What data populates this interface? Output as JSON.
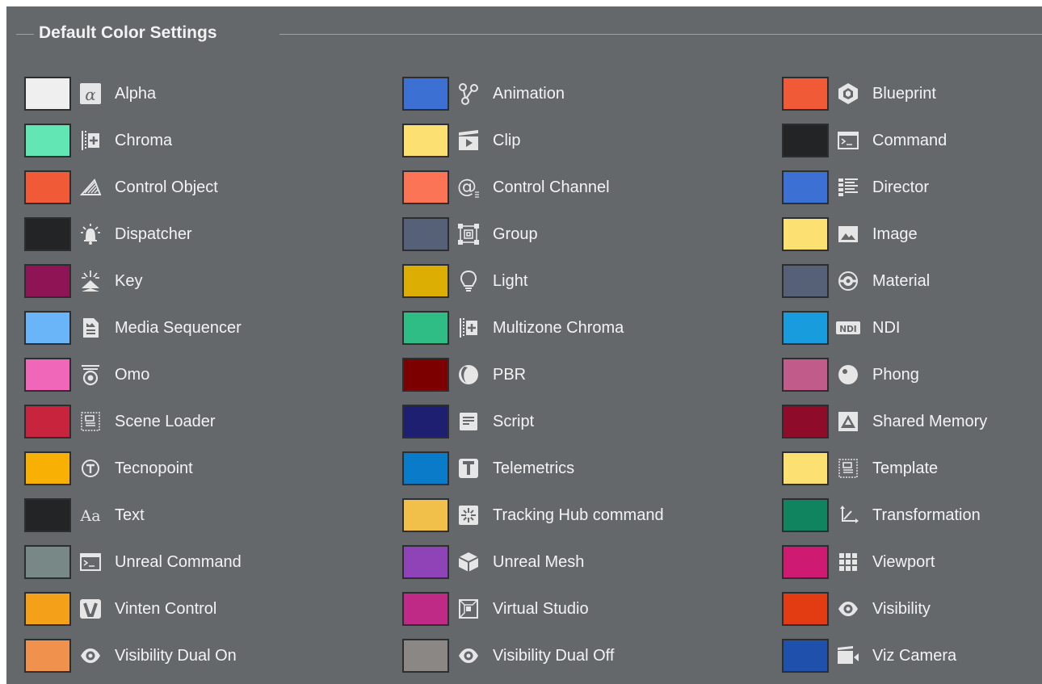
{
  "section": {
    "title": "Default Color Settings"
  },
  "colors": {
    "panel_bg": "#65686b",
    "text": "#f3f3f3",
    "icon": "#e6e6e6"
  },
  "items": [
    {
      "label": "Alpha",
      "color": "#efefef",
      "icon": "alpha-icon"
    },
    {
      "label": "Animation",
      "color": "#3c70d3",
      "icon": "animation-icon"
    },
    {
      "label": "Blueprint",
      "color": "#f05a36",
      "icon": "blueprint-icon"
    },
    {
      "label": "Chroma",
      "color": "#62e6b4",
      "icon": "chroma-icon"
    },
    {
      "label": "Clip",
      "color": "#fde072",
      "icon": "clip-icon"
    },
    {
      "label": "Command",
      "color": "#232425",
      "icon": "command-icon"
    },
    {
      "label": "Control Object",
      "color": "#f05a36",
      "icon": "control-object-icon"
    },
    {
      "label": "Control Channel",
      "color": "#fb7456",
      "icon": "control-channel-icon"
    },
    {
      "label": "Director",
      "color": "#3c70d3",
      "icon": "director-icon"
    },
    {
      "label": "Dispatcher",
      "color": "#232425",
      "icon": "dispatcher-icon"
    },
    {
      "label": "Group",
      "color": "#566077",
      "icon": "group-icon"
    },
    {
      "label": "Image",
      "color": "#fde072",
      "icon": "image-icon"
    },
    {
      "label": "Key",
      "color": "#8f1456",
      "icon": "key-icon"
    },
    {
      "label": "Light",
      "color": "#dcae04",
      "icon": "light-icon"
    },
    {
      "label": "Material",
      "color": "#566077",
      "icon": "material-icon"
    },
    {
      "label": "Media Sequencer",
      "color": "#6ab5f8",
      "icon": "media-sequencer-icon"
    },
    {
      "label": "Multizone Chroma",
      "color": "#2fbd85",
      "icon": "multizone-chroma-icon"
    },
    {
      "label": "NDI",
      "color": "#199cdd",
      "icon": "ndi-icon"
    },
    {
      "label": "Omo",
      "color": "#f067b9",
      "icon": "omo-icon"
    },
    {
      "label": "PBR",
      "color": "#7d0000",
      "icon": "pbr-icon"
    },
    {
      "label": "Phong",
      "color": "#c05b8a",
      "icon": "phong-icon"
    },
    {
      "label": "Scene Loader",
      "color": "#c8243e",
      "icon": "scene-loader-icon"
    },
    {
      "label": "Script",
      "color": "#1e1f70",
      "icon": "script-icon"
    },
    {
      "label": "Shared Memory",
      "color": "#8e0c2a",
      "icon": "shared-memory-icon"
    },
    {
      "label": "Tecnopoint",
      "color": "#f8b004",
      "icon": "tecnopoint-icon"
    },
    {
      "label": "Telemetrics",
      "color": "#0a7bc8",
      "icon": "telemetrics-icon"
    },
    {
      "label": "Template",
      "color": "#fde072",
      "icon": "template-icon"
    },
    {
      "label": "Text",
      "color": "#232425",
      "icon": "text-icon"
    },
    {
      "label": "Tracking Hub command",
      "color": "#f0c04a",
      "icon": "tracking-hub-icon"
    },
    {
      "label": "Transformation",
      "color": "#10845e",
      "icon": "transformation-icon"
    },
    {
      "label": "Unreal Command",
      "color": "#788887",
      "icon": "unreal-command-icon"
    },
    {
      "label": "Unreal Mesh",
      "color": "#8e44b6",
      "icon": "unreal-mesh-icon"
    },
    {
      "label": "Viewport",
      "color": "#cf1a72",
      "icon": "viewport-icon"
    },
    {
      "label": "Vinten Control",
      "color": "#f4a019",
      "icon": "vinten-control-icon"
    },
    {
      "label": "Virtual Studio",
      "color": "#bf2a86",
      "icon": "virtual-studio-icon"
    },
    {
      "label": "Visibility",
      "color": "#e43c12",
      "icon": "visibility-icon"
    },
    {
      "label": "Visibility Dual On",
      "color": "#f0914e",
      "icon": "visibility-icon"
    },
    {
      "label": "Visibility Dual Off",
      "color": "#8a8785",
      "icon": "visibility-icon"
    },
    {
      "label": "Viz Camera",
      "color": "#1f50ac",
      "icon": "viz-camera-icon"
    }
  ]
}
